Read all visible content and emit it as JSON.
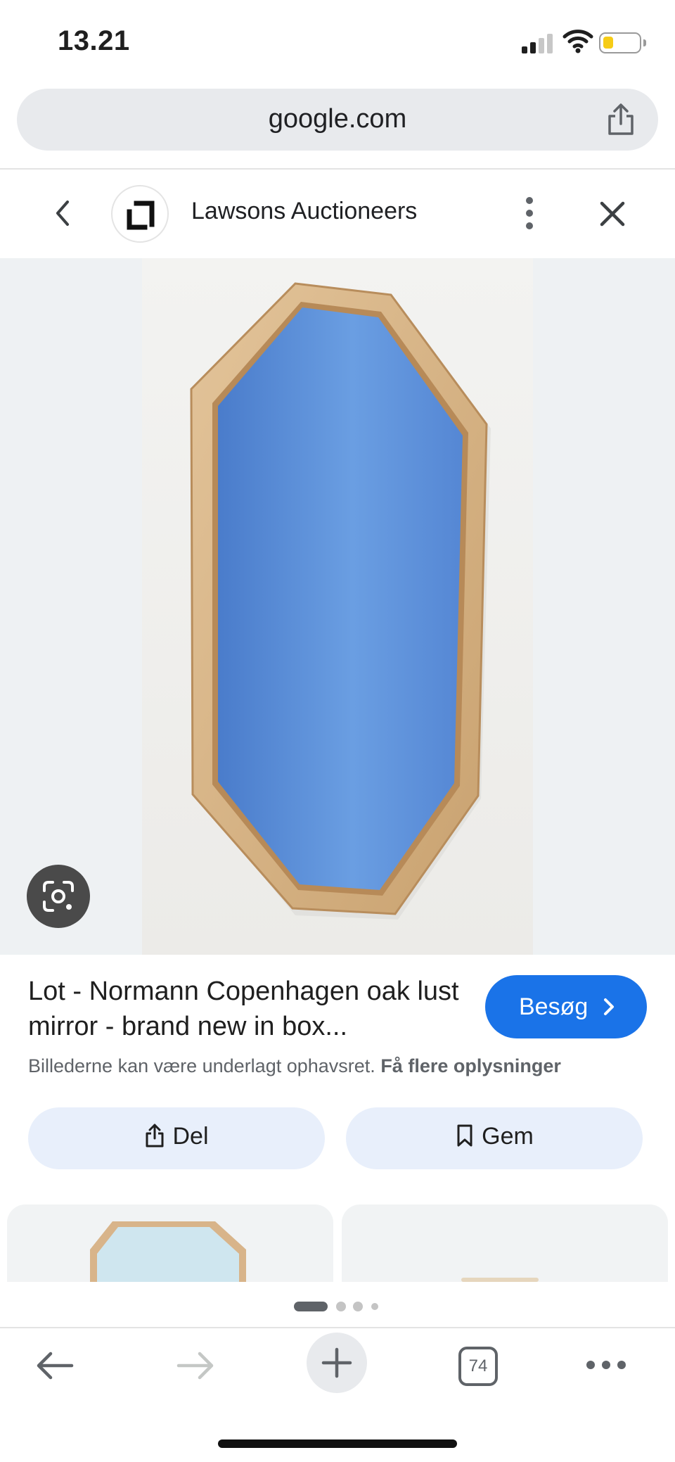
{
  "status_bar": {
    "time": "13.21",
    "battery_color": "#f6cc16"
  },
  "url_bar": {
    "domain": "google.com"
  },
  "panel": {
    "site_name": "Lawsons Auctioneers"
  },
  "result": {
    "title": "Lot - Normann Copenhagen oak lust mirror - brand new in box...",
    "visit_label": "Besøg",
    "copyright_text": "Billederne kan være underlagt ophavsret.",
    "copyright_link": "Få flere oplysninger"
  },
  "actions": {
    "share_label": "Del",
    "save_label": "Gem"
  },
  "toolbar": {
    "tab_count": "74"
  },
  "colors": {
    "accent": "#1a73e8",
    "chip_bg": "#e8effb",
    "mirror": "#5b8fd6",
    "frame_wood": "#d9b98e"
  },
  "icons": [
    "signal-icon",
    "wifi-icon",
    "battery-icon",
    "share-icon",
    "chevron-left-icon",
    "site-logo-icon",
    "more-vert-icon",
    "close-icon",
    "lens-icon",
    "chevron-right-icon",
    "bookmark-icon",
    "arrow-back-icon",
    "arrow-forward-icon",
    "plus-icon",
    "tabs-icon",
    "more-horiz-icon"
  ]
}
